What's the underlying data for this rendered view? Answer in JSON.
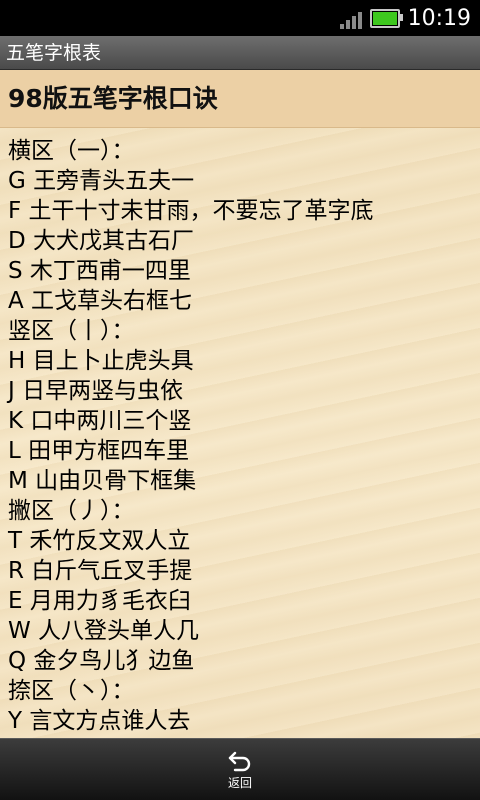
{
  "status_bar": {
    "time": "10:19",
    "battery_color": "#3ec81e"
  },
  "app": {
    "title": "五笔字根表"
  },
  "content": {
    "heading": "98版五笔字根口诀",
    "lines": [
      "横区（一）：",
      "G 王旁青头五夫一",
      "F 土干十寸未甘雨，不要忘了革字底",
      "D 大犬戊其古石厂",
      "S 木丁西甫一四里",
      "A 工戈草头右框七",
      "竖区（丨）：",
      "H 目上卜止虎头具",
      "J 日早两竖与虫依",
      "K 口中两川三个竖",
      "L 田甲方框四车里",
      "M 山由贝骨下框集",
      "撇区（丿）：",
      "T 禾竹反文双人立",
      "R 白斤气丘叉手提",
      "E 月用力豸毛衣臼",
      "W 人八登头单人几",
      "Q 金夕鸟儿犭边鱼",
      "捺区（丶）：",
      "Y 言文方点谁人去"
    ]
  },
  "bottom_bar": {
    "back_label": "返回",
    "back_icon": "back-arrow-icon"
  }
}
